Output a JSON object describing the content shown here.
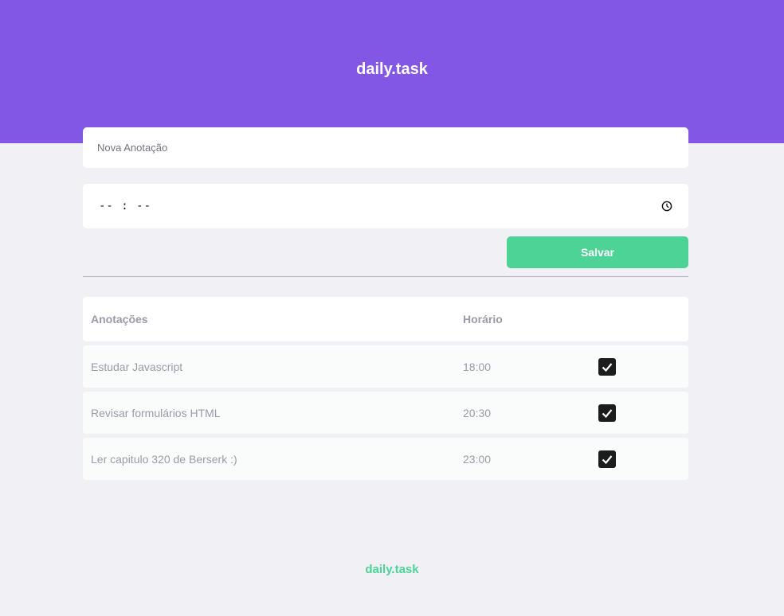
{
  "header": {
    "brand": "daily.task"
  },
  "form": {
    "note_placeholder": "Nova Anotação",
    "time_value": "-- : --",
    "save_label": "Salvar"
  },
  "table": {
    "headers": [
      "Anotações",
      "Horário"
    ],
    "rows": [
      {
        "note": "Estudar Javascript",
        "time": "18:00",
        "checked": true
      },
      {
        "note": "Revisar formulários HTML",
        "time": "20:30",
        "checked": true
      },
      {
        "note": "Ler capitulo 320 de Berserk :)",
        "time": "23:00",
        "checked": true
      }
    ]
  },
  "footer": {
    "brand": "daily.task"
  },
  "colors": {
    "primary": "#8257e6",
    "accent": "#4cd395",
    "background": "#f0f0f5"
  },
  "icons": {
    "time": "clock-icon",
    "done": "checkbox-checked-icon"
  }
}
